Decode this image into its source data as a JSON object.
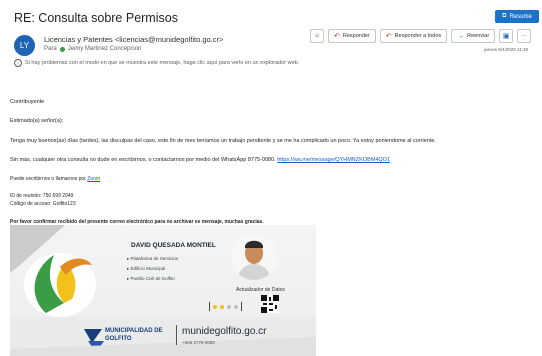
{
  "email": {
    "subject": "RE: Consulta sobre Permisos",
    "resume_label": "Resume",
    "avatar_initials": "LY",
    "from": "Licencias y Patentes <licencias@munidegolfito.go.cr>",
    "to_label": "Para",
    "to": "Jeimy Martinez Concepcion",
    "date": "jueves 9/4/2020 11:29",
    "info": "Si hay problemas con el modo en que se muestra este mensaje, haga clic aquí para verlo en un explorador web."
  },
  "toolbar": {
    "reply": "Responder",
    "reply_all": "Responder a todos",
    "forward": "Reenviar",
    "more": "···"
  },
  "body": {
    "line1": "Contribuyente",
    "line2": "Estimado(a) señor(a):",
    "line3": "Tenga muy buenos(as) días (tardes), las disculpas del caso, este fin de mes teníamos un trabajo pendiente y se me ha complicado un poco. Ya estoy poniendome al corriente.",
    "line4": "Sin más, cualquier otra consulta no dude en escribirnos, o contactarnos por medio del WhatsApp 8775-0080. ",
    "line4_link": "https://wa.me/message/QYHMNZKOBM4QO1",
    "line5": "Puede escribirnos o llamarnos por ",
    "line5_link": "Zoom",
    "meeting_id": "ID de reunión: 750 699 2949",
    "access_code": "Código de acceso: Golfito123",
    "confirm": "Por favor confirmar recibido del presente correo electrónico para no archivar se mensaje, muchas gracias."
  },
  "signature": {
    "name": "DAVID QUESADA MONTIEL",
    "bullets": [
      "Plataforma de Servicios",
      "Edificio Municipal",
      "Pueblo Civil de Golfito"
    ],
    "role": "Actualizador de Datos",
    "org_line1": "MUNICIPALIDAD DE",
    "org_line2": "GOLFITO",
    "website": "munidegolfito.go.cr",
    "phone": "+506 2775-0080",
    "colors": {
      "green": "#3a9d46",
      "yellow": "#f2c21b",
      "navy": "#1b3c7a",
      "blue": "#1a73c9"
    }
  }
}
